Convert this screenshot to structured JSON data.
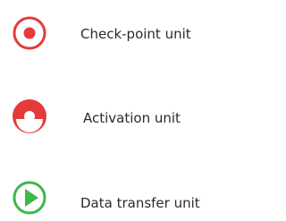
{
  "legend": {
    "items": [
      {
        "label": "Check-point unit",
        "icon": "checkpoint-unit-icon",
        "color": "#e63a3a"
      },
      {
        "label": "Activation unit",
        "icon": "activation-unit-icon",
        "color": "#e63a3a"
      },
      {
        "label": "Data transfer unit",
        "icon": "data-transfer-unit-icon",
        "color": "#3db84a"
      }
    ]
  }
}
